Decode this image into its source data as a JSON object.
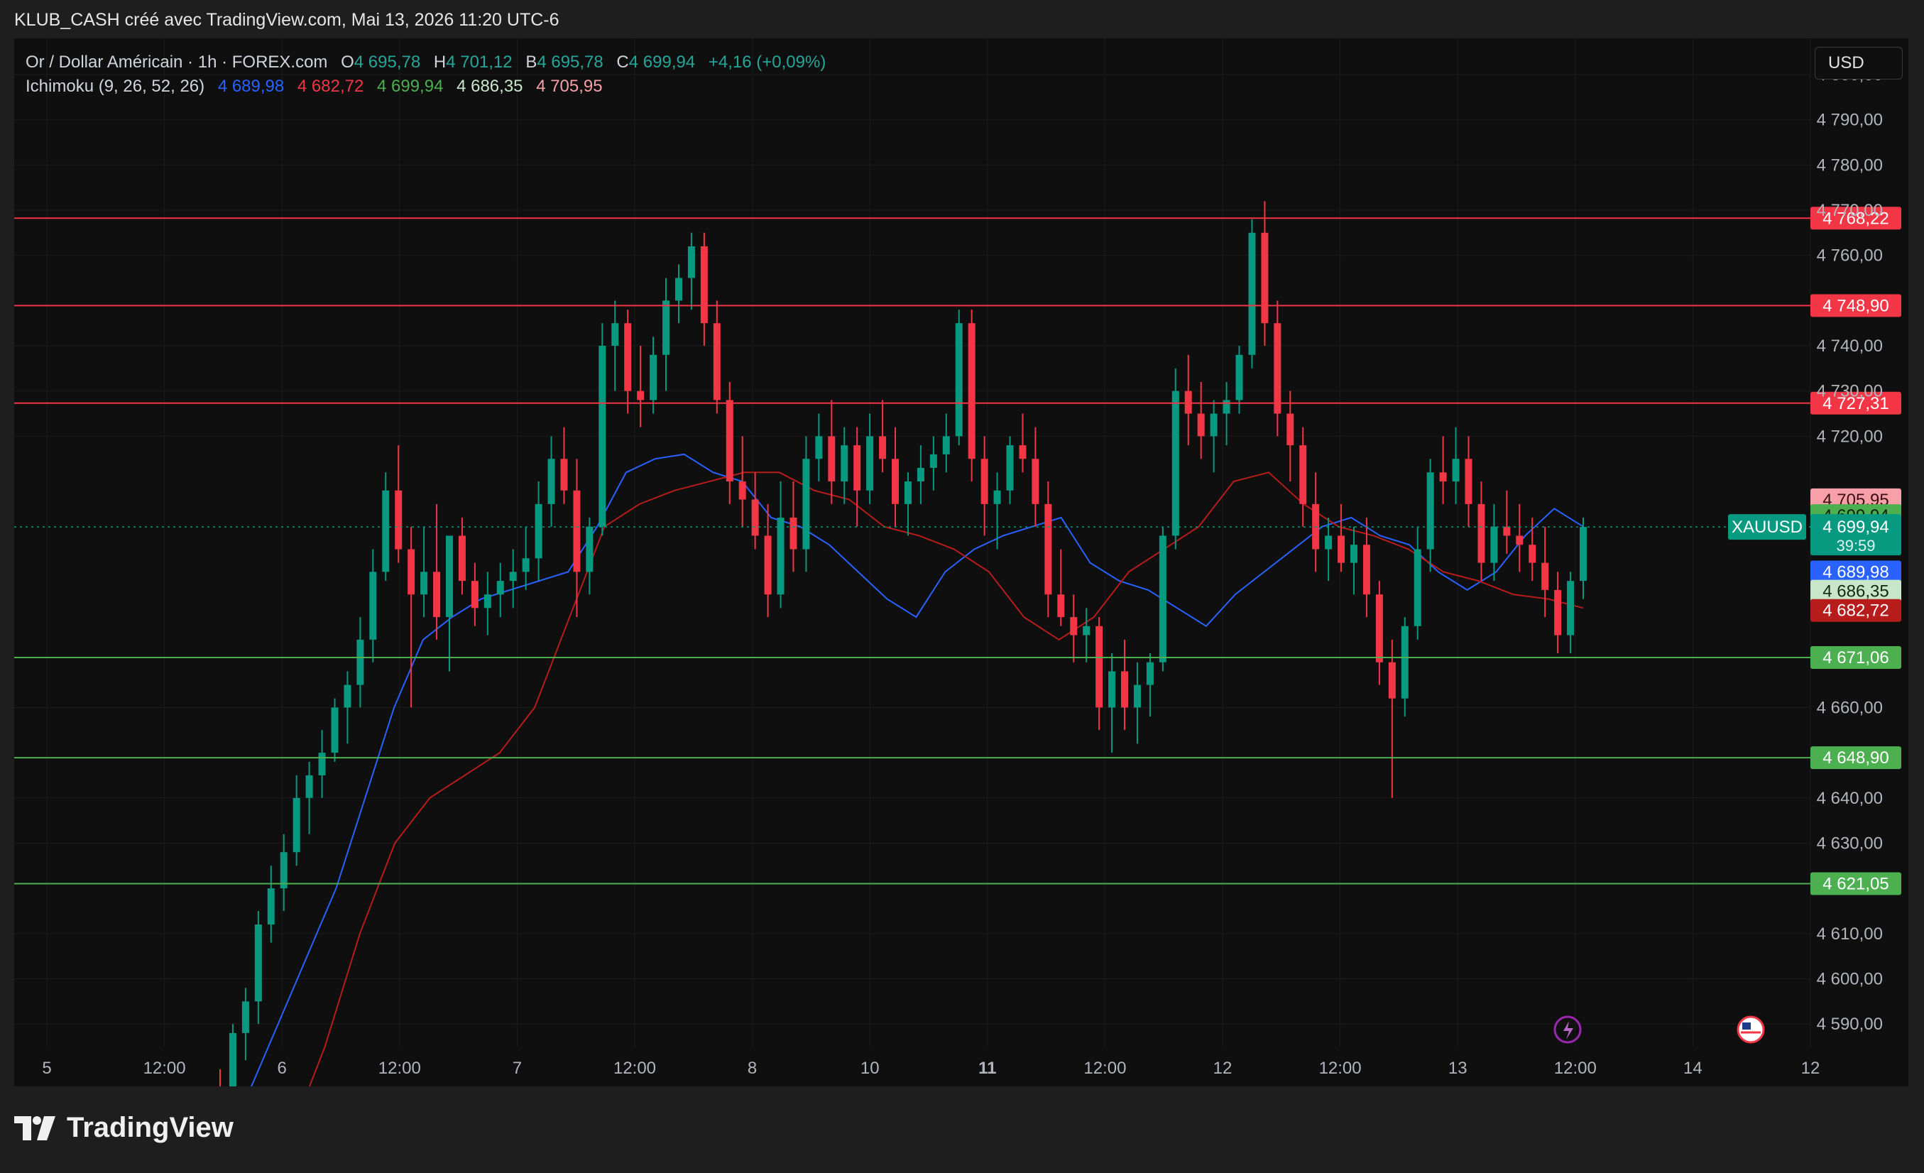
{
  "header": {
    "title": "KLUB_CASH créé avec TradingView.com, Mai 13, 2026 11:20 UTC-6"
  },
  "legend": {
    "symbol": "Or / Dollar Américain · 1h · FOREX.com",
    "o_label": "O",
    "o_value": "4 695,78",
    "h_label": "H",
    "h_value": "4 701,12",
    "b_label": "B",
    "b_value": "4 695,78",
    "c_label": "C",
    "c_value": "4 699,94",
    "change": "+4,16 (+0,09%)",
    "ichimoku_name": "Ichimoku (9, 26, 52, 26)",
    "ichimoku_values": [
      "4 689,98",
      "4 682,72",
      "4 699,94",
      "4 686,35",
      "4 705,95"
    ]
  },
  "currency_button": "USD",
  "y_axis": {
    "ticks": [
      "4 800,00",
      "4 790,00",
      "4 780,00",
      "4 770,00",
      "4 760,00",
      "4 740,00",
      "4 730,00",
      "4 720,00",
      "4 660,00",
      "4 640,00",
      "4 630,00",
      "4 610,00",
      "4 600,00",
      "4 590,00"
    ],
    "tick_values": [
      4800,
      4790,
      4780,
      4770,
      4760,
      4740,
      4730,
      4720,
      4660,
      4640,
      4630,
      4610,
      4600,
      4590
    ]
  },
  "x_axis": {
    "labels": [
      "5",
      "12:00",
      "6",
      "12:00",
      "7",
      "12:00",
      "8",
      "10",
      "11",
      "12:00",
      "12",
      "12:00",
      "13",
      "12:00",
      "14",
      "12"
    ],
    "bold_index": 8
  },
  "horizontal_levels": [
    {
      "label": "4 768,22",
      "value": 4768.22,
      "color": "#f23645"
    },
    {
      "label": "4 748,90",
      "value": 4748.9,
      "color": "#f23645"
    },
    {
      "label": "4 727,31",
      "value": 4727.31,
      "color": "#f23645"
    },
    {
      "label": "4 671,06",
      "value": 4671.06,
      "color": "#4caf50"
    },
    {
      "label": "4 648,90",
      "value": 4648.9,
      "color": "#4caf50"
    },
    {
      "label": "4 621,05",
      "value": 4621.05,
      "color": "#4caf50"
    }
  ],
  "price_tags": [
    {
      "label": "4 705,95",
      "value": 4705.95,
      "bg": "#f7a0a8",
      "fg": "#3a0d12"
    },
    {
      "label": "4 699,94",
      "value": 4699.94,
      "bg": "#4caf50",
      "fg": "#0b1f0b",
      "offset": -16
    },
    {
      "label": "4 689,98",
      "value": 4689.98,
      "bg": "#2962ff",
      "fg": "#ffffff"
    },
    {
      "label": "4 686,35",
      "value": 4686.35,
      "bg": "#c8e6c9",
      "fg": "#0f2a10",
      "offset": 4
    },
    {
      "label": "4 682,72",
      "value": 4682.72,
      "bg": "#b71c1c",
      "fg": "#ffffff",
      "offset": 8
    }
  ],
  "current_price": {
    "symbol": "XAUUSD",
    "price": "4 699,94",
    "countdown": "39:59",
    "value": 4699.94,
    "color": "#089981"
  },
  "branding": {
    "logo_text": "TradingView"
  },
  "colors": {
    "up": "#089981",
    "down": "#f23645",
    "tenkan": "#2962ff",
    "kijun": "#b71c1c",
    "chikou": "#43a047",
    "span_a": "#a5d6a7",
    "span_b": "#ef9a9a",
    "cloud_up": "#1f3d1f",
    "cloud_down": "#4a1a1a"
  },
  "chart_data": {
    "type": "candlestick",
    "instrument": "XAUUSD",
    "ylim": [
      4585,
      4808
    ],
    "candles": [
      [
        4575,
        4580,
        4560,
        4570
      ],
      [
        4570,
        4590,
        4565,
        4588
      ],
      [
        4588,
        4598,
        4582,
        4595
      ],
      [
        4595,
        4615,
        4590,
        4612
      ],
      [
        4612,
        4625,
        4608,
        4620
      ],
      [
        4620,
        4632,
        4615,
        4628
      ],
      [
        4628,
        4645,
        4625,
        4640
      ],
      [
        4640,
        4648,
        4632,
        4645
      ],
      [
        4645,
        4655,
        4640,
        4650
      ],
      [
        4650,
        4662,
        4648,
        4660
      ],
      [
        4660,
        4668,
        4652,
        4665
      ],
      [
        4665,
        4680,
        4660,
        4675
      ],
      [
        4675,
        4695,
        4670,
        4690
      ],
      [
        4690,
        4712,
        4688,
        4708
      ],
      [
        4708,
        4718,
        4692,
        4695
      ],
      [
        4695,
        4700,
        4660,
        4685
      ],
      [
        4685,
        4700,
        4680,
        4690
      ],
      [
        4690,
        4705,
        4675,
        4680
      ],
      [
        4680,
        4695,
        4668,
        4698
      ],
      [
        4698,
        4702,
        4685,
        4688
      ],
      [
        4688,
        4692,
        4678,
        4682
      ],
      [
        4682,
        4690,
        4676,
        4685
      ],
      [
        4685,
        4692,
        4680,
        4688
      ],
      [
        4688,
        4695,
        4682,
        4690
      ],
      [
        4690,
        4700,
        4686,
        4693
      ],
      [
        4693,
        4710,
        4688,
        4705
      ],
      [
        4705,
        4720,
        4700,
        4715
      ],
      [
        4715,
        4722,
        4705,
        4708
      ],
      [
        4708,
        4715,
        4680,
        4690
      ],
      [
        4690,
        4702,
        4685,
        4700
      ],
      [
        4700,
        4745,
        4698,
        4740
      ],
      [
        4740,
        4750,
        4730,
        4745
      ],
      [
        4745,
        4748,
        4725,
        4730
      ],
      [
        4730,
        4740,
        4722,
        4728
      ],
      [
        4728,
        4742,
        4725,
        4738
      ],
      [
        4738,
        4755,
        4730,
        4750
      ],
      [
        4750,
        4758,
        4745,
        4755
      ],
      [
        4755,
        4765,
        4748,
        4762
      ],
      [
        4762,
        4765,
        4740,
        4745
      ],
      [
        4745,
        4750,
        4725,
        4728
      ],
      [
        4728,
        4732,
        4705,
        4710
      ],
      [
        4710,
        4720,
        4700,
        4706
      ],
      [
        4706,
        4712,
        4695,
        4698
      ],
      [
        4698,
        4705,
        4680,
        4685
      ],
      [
        4685,
        4710,
        4682,
        4702
      ],
      [
        4702,
        4710,
        4690,
        4695
      ],
      [
        4695,
        4720,
        4690,
        4715
      ],
      [
        4715,
        4725,
        4710,
        4720
      ],
      [
        4720,
        4728,
        4705,
        4710
      ],
      [
        4710,
        4722,
        4705,
        4718
      ],
      [
        4718,
        4722,
        4700,
        4708
      ],
      [
        4708,
        4725,
        4705,
        4720
      ],
      [
        4720,
        4728,
        4712,
        4715
      ],
      [
        4715,
        4722,
        4700,
        4705
      ],
      [
        4705,
        4712,
        4698,
        4710
      ],
      [
        4710,
        4718,
        4705,
        4713
      ],
      [
        4713,
        4720,
        4708,
        4716
      ],
      [
        4716,
        4725,
        4712,
        4720
      ],
      [
        4720,
        4748,
        4718,
        4745
      ],
      [
        4745,
        4748,
        4710,
        4715
      ],
      [
        4715,
        4720,
        4698,
        4705
      ],
      [
        4705,
        4712,
        4695,
        4708
      ],
      [
        4708,
        4720,
        4705,
        4718
      ],
      [
        4718,
        4725,
        4712,
        4715
      ],
      [
        4715,
        4722,
        4700,
        4705
      ],
      [
        4705,
        4710,
        4680,
        4685
      ],
      [
        4685,
        4695,
        4678,
        4680
      ],
      [
        4680,
        4685,
        4670,
        4676
      ],
      [
        4676,
        4682,
        4670,
        4678
      ],
      [
        4678,
        4680,
        4655,
        4660
      ],
      [
        4660,
        4672,
        4650,
        4668
      ],
      [
        4668,
        4675,
        4655,
        4660
      ],
      [
        4660,
        4670,
        4652,
        4665
      ],
      [
        4665,
        4672,
        4658,
        4670
      ],
      [
        4670,
        4700,
        4668,
        4698
      ],
      [
        4698,
        4735,
        4695,
        4730
      ],
      [
        4730,
        4738,
        4718,
        4725
      ],
      [
        4725,
        4732,
        4715,
        4720
      ],
      [
        4720,
        4728,
        4712,
        4725
      ],
      [
        4725,
        4732,
        4718,
        4728
      ],
      [
        4728,
        4740,
        4725,
        4738
      ],
      [
        4738,
        4768,
        4735,
        4765
      ],
      [
        4765,
        4772,
        4740,
        4745
      ],
      [
        4745,
        4750,
        4720,
        4725
      ],
      [
        4725,
        4730,
        4710,
        4718
      ],
      [
        4718,
        4722,
        4700,
        4705
      ],
      [
        4705,
        4712,
        4690,
        4695
      ],
      [
        4695,
        4702,
        4688,
        4698
      ],
      [
        4698,
        4705,
        4690,
        4692
      ],
      [
        4692,
        4700,
        4685,
        4696
      ],
      [
        4696,
        4702,
        4680,
        4685
      ],
      [
        4685,
        4688,
        4665,
        4670
      ],
      [
        4670,
        4675,
        4640,
        4662
      ],
      [
        4662,
        4680,
        4658,
        4678
      ],
      [
        4678,
        4700,
        4675,
        4695
      ],
      [
        4695,
        4715,
        4690,
        4712
      ],
      [
        4712,
        4720,
        4705,
        4710
      ],
      [
        4710,
        4722,
        4705,
        4715
      ],
      [
        4715,
        4720,
        4700,
        4705
      ],
      [
        4705,
        4710,
        4688,
        4692
      ],
      [
        4692,
        4705,
        4688,
        4700
      ],
      [
        4700,
        4708,
        4694,
        4698
      ],
      [
        4698,
        4705,
        4690,
        4696
      ],
      [
        4696,
        4702,
        4688,
        4692
      ],
      [
        4692,
        4700,
        4680,
        4686
      ],
      [
        4686,
        4690,
        4672,
        4676
      ],
      [
        4676,
        4690,
        4672,
        4688
      ],
      [
        4688,
        4702,
        4684,
        4699.94
      ]
    ],
    "series": [
      {
        "name": "Tenkan",
        "values": [
          4560,
          4575,
          4590,
          4605,
          4620,
          4640,
          4660,
          4675,
          4680,
          4684,
          4686,
          4688,
          4690,
          4700,
          4712,
          4715,
          4716,
          4712,
          4710,
          4702,
          4700,
          4696,
          4690,
          4684,
          4680,
          4690,
          4695,
          4698,
          4700,
          4702,
          4692,
          4688,
          4686,
          4682,
          4678,
          4685,
          4690,
          4695,
          4700,
          4702,
          4698,
          4696,
          4690,
          4686,
          4690,
          4698,
          4704,
          4700
        ]
      },
      {
        "name": "Kijun",
        "values": [
          4545,
          4555,
          4565,
          4585,
          4610,
          4630,
          4640,
          4645,
          4650,
          4660,
          4680,
          4700,
          4705,
          4708,
          4710,
          4712,
          4712,
          4708,
          4706,
          4700,
          4698,
          4695,
          4690,
          4680,
          4675,
          4680,
          4690,
          4695,
          4700,
          4710,
          4712,
          4705,
          4700,
          4698,
          4695,
          4690,
          4688,
          4685,
          4684,
          4682
        ]
      }
    ]
  }
}
